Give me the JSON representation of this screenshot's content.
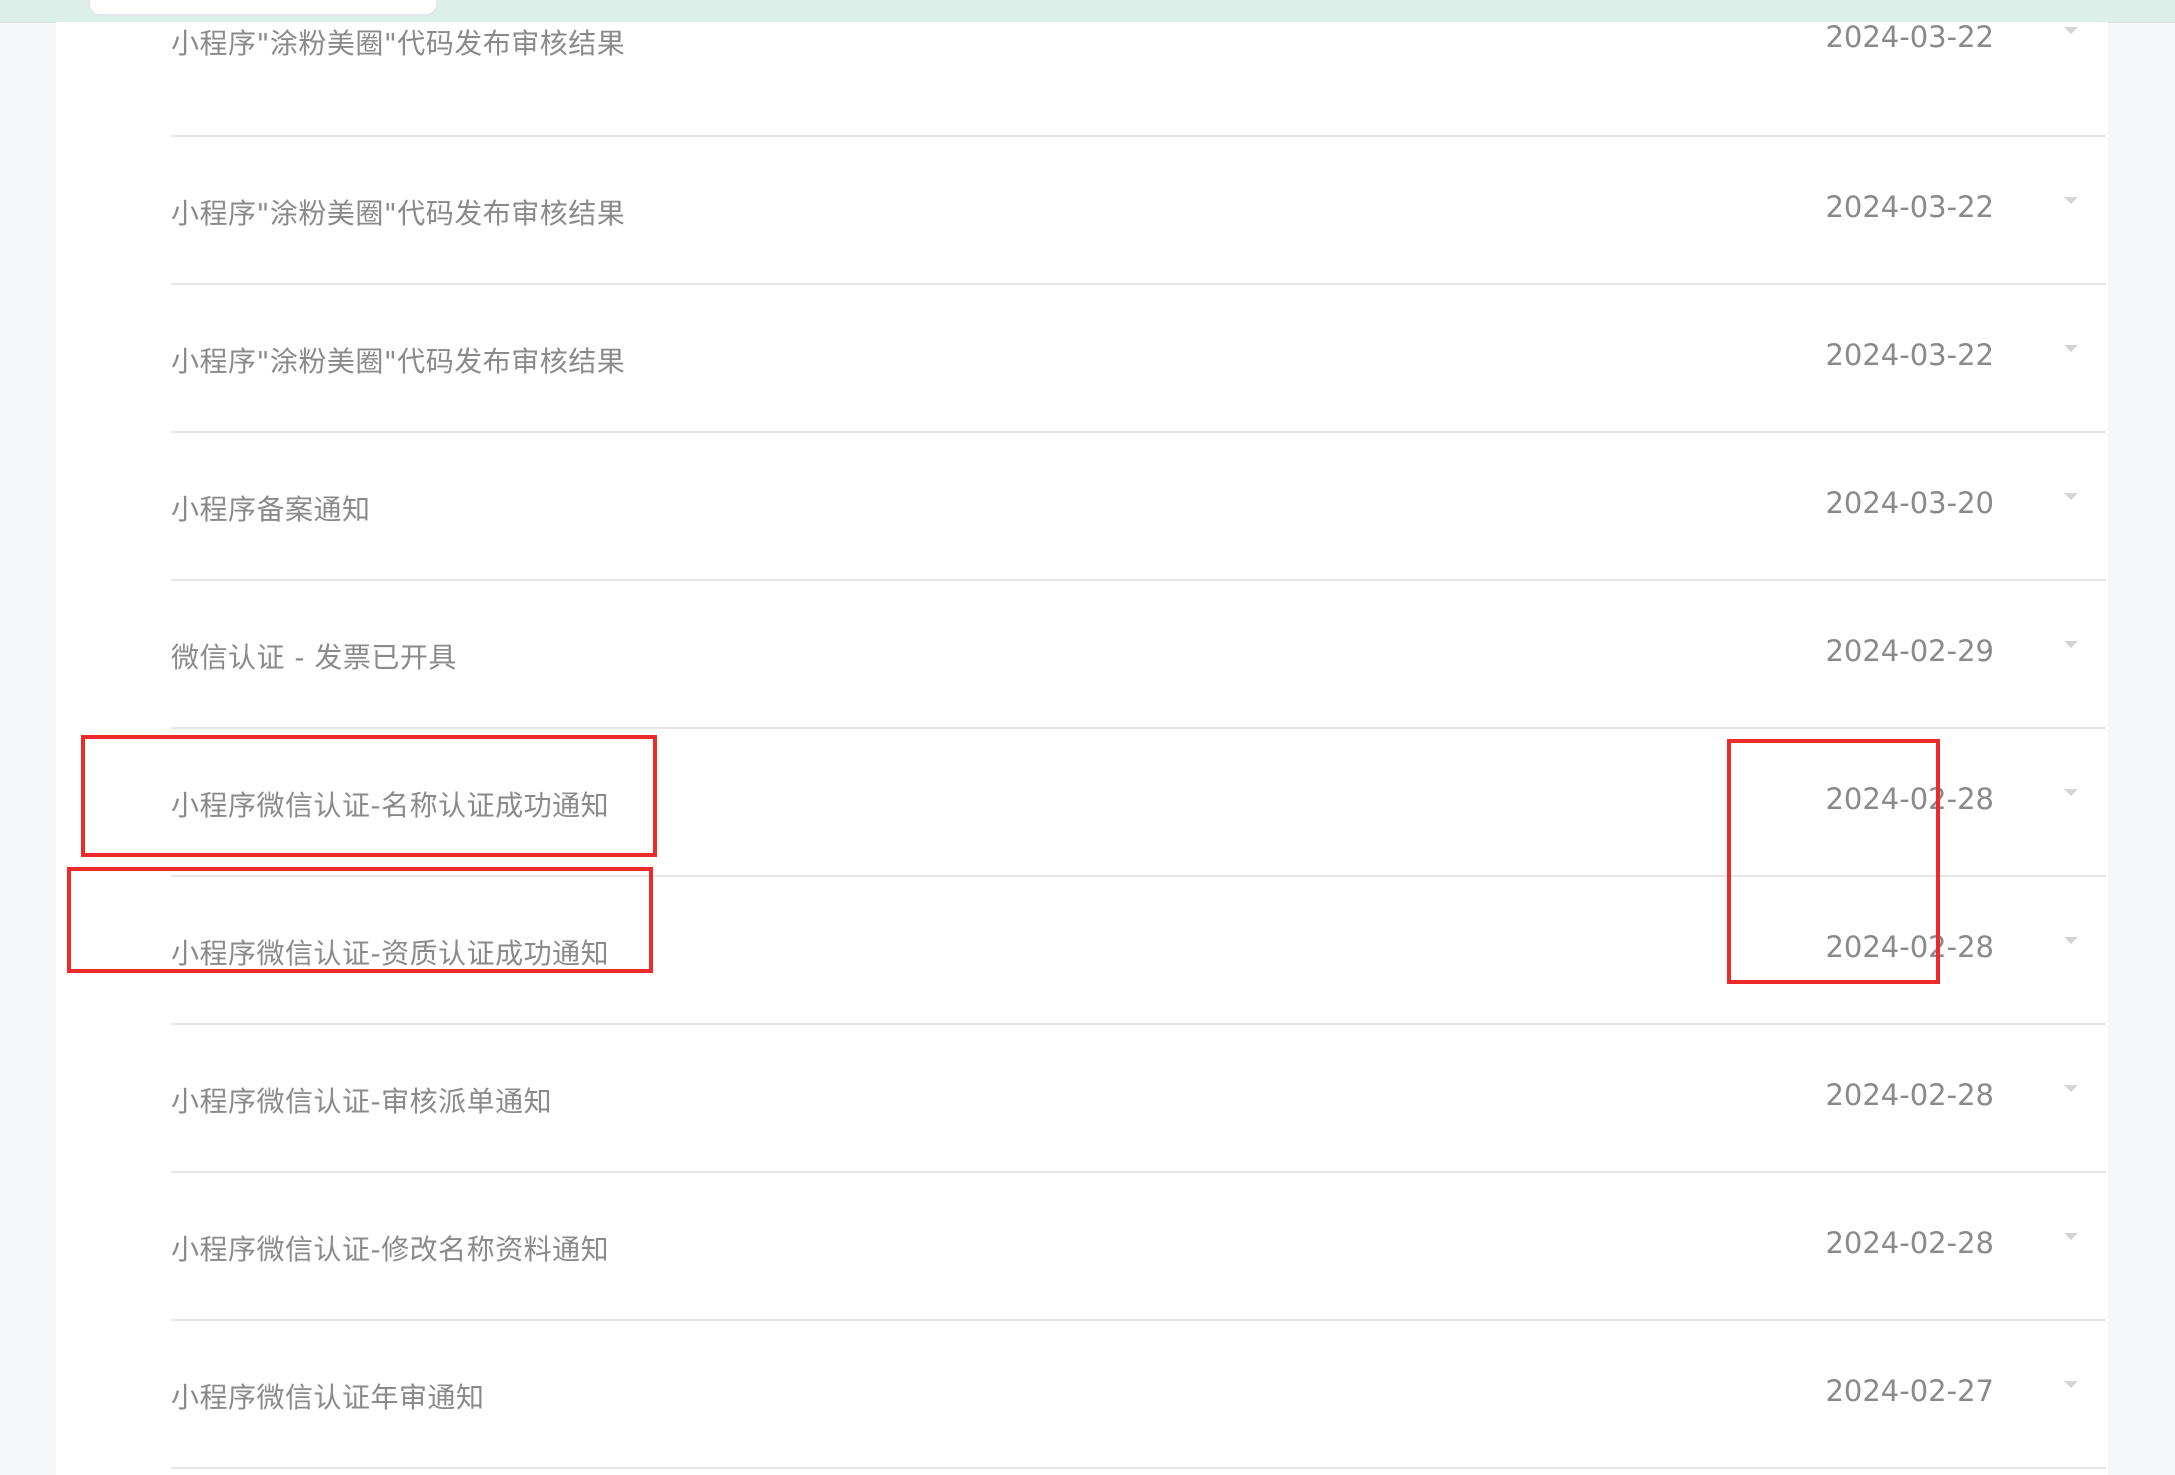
{
  "notifications": [
    {
      "title": "小程序\"涂粉美圈\"代码发布审核结果",
      "date": "2024-03-22"
    },
    {
      "title": "小程序\"涂粉美圈\"代码发布审核结果",
      "date": "2024-03-22"
    },
    {
      "title": "小程序\"涂粉美圈\"代码发布审核结果",
      "date": "2024-03-22"
    },
    {
      "title": "小程序备案通知",
      "date": "2024-03-20"
    },
    {
      "title": "微信认证 - 发票已开具",
      "date": "2024-02-29"
    },
    {
      "title": "小程序微信认证-名称认证成功通知",
      "date": "2024-02-28"
    },
    {
      "title": "小程序微信认证-资质认证成功通知",
      "date": "2024-02-28"
    },
    {
      "title": "小程序微信认证-审核派单通知",
      "date": "2024-02-28"
    },
    {
      "title": "小程序微信认证-修改名称资料通知",
      "date": "2024-02-28"
    },
    {
      "title": "小程序微信认证年审通知",
      "date": "2024-02-27"
    }
  ],
  "icons": {
    "expand": "caret-down-icon"
  },
  "colors": {
    "highlight": "#ec2a2a",
    "text": "#8a8a8a",
    "top_bar": "#dcefe9"
  }
}
